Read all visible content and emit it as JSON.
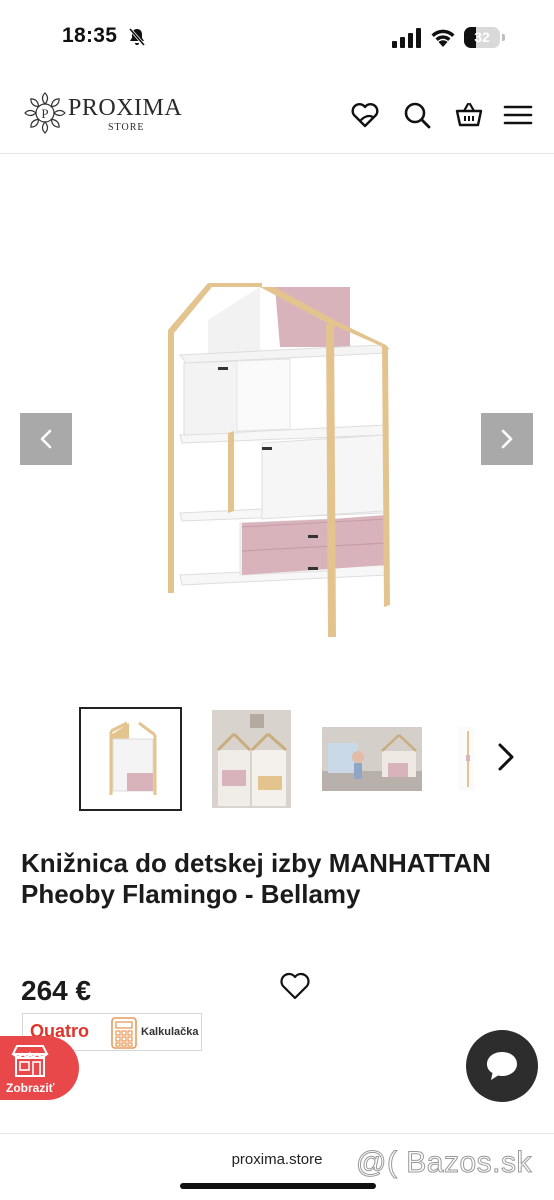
{
  "status": {
    "time": "18:35",
    "battery": "32",
    "battery_level": 0.32
  },
  "header": {
    "logo_name": "PROXIMA",
    "logo_sub": "STORE",
    "icons": [
      "wishlist-heart-icon",
      "search-icon",
      "basket-icon",
      "hamburger-menu-icon"
    ]
  },
  "gallery": {
    "prev_icon": "chevron-left-icon",
    "next_icon": "chevron-right-icon",
    "thumbnail_count": 4,
    "active_thumbnail": 1
  },
  "product": {
    "title": "Knižnica do detskej izby MANHATTAN Pheoby Flamingo - Bellamy",
    "price": "264 €"
  },
  "quatro": {
    "logo": "Quatro",
    "label": "Kalkulačka"
  },
  "store_button": {
    "label": "Zobraziť"
  },
  "browser": {
    "url": "proxima.store"
  },
  "watermark": "@( Bazos.sk",
  "colors": {
    "accent_red": "#e8484a",
    "quatro_red": "#e0332a",
    "arrow_gray": "#a9a9a9",
    "chat_dark": "#2d2d2d",
    "pink": "#d9b3bb",
    "wood": "#e3c48f"
  }
}
